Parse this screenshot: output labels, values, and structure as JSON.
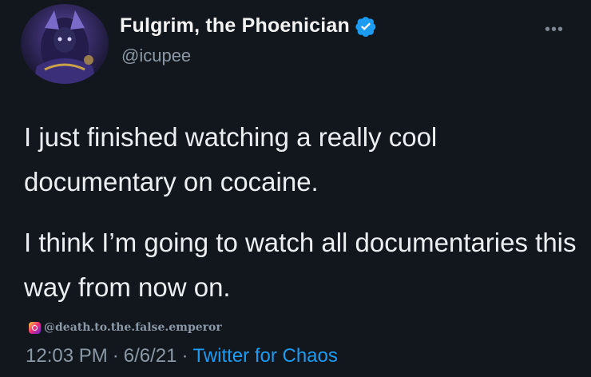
{
  "tweet": {
    "display_name": "Fulgrim, the Phoenician",
    "handle": "@icupee",
    "verified_icon": "verified-badge-icon",
    "more_icon": "more-options-icon",
    "paragraphs": [
      "I just finished watching a really cool documentary on cocaine.",
      "I think I’m going to watch all documentaries this way from now on."
    ],
    "watermark": "@death.to.the.false.emperor",
    "time": "12:03 PM",
    "separator": "·",
    "date": "6/6/21",
    "source": "Twitter for Chaos",
    "colors": {
      "background": "#12161d",
      "link": "#1d9bf0",
      "verified": "#1d9bf0",
      "muted": "#8b98a5"
    }
  }
}
